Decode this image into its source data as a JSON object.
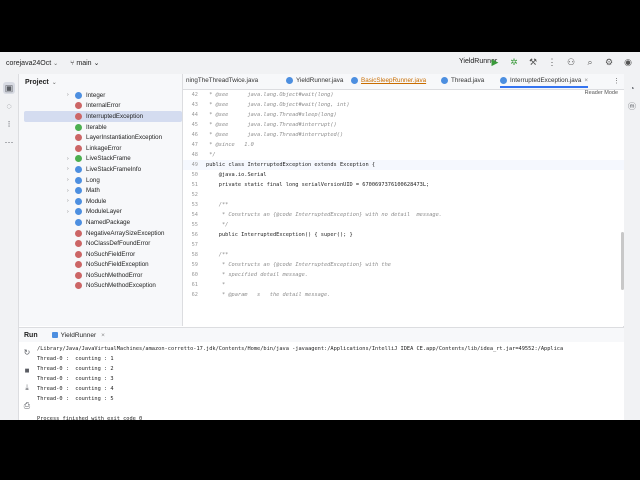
{
  "titlebar": {
    "project": "corejava24Oct",
    "branch": "main",
    "run_config": "YieldRunner"
  },
  "project_panel": {
    "title": "Project",
    "items": [
      {
        "label": "Integer",
        "kind": "class",
        "arrow": true
      },
      {
        "label": "InternalError",
        "kind": "error",
        "arrow": false
      },
      {
        "label": "InterruptedException",
        "kind": "error",
        "arrow": false,
        "selected": true
      },
      {
        "label": "Iterable",
        "kind": "interface",
        "arrow": false
      },
      {
        "label": "LayerInstantiationException",
        "kind": "error",
        "arrow": false
      },
      {
        "label": "LinkageError",
        "kind": "error",
        "arrow": false
      },
      {
        "label": "LiveStackFrame",
        "kind": "interface",
        "arrow": true
      },
      {
        "label": "LiveStackFrameInfo",
        "kind": "class",
        "arrow": true
      },
      {
        "label": "Long",
        "kind": "class",
        "arrow": true
      },
      {
        "label": "Math",
        "kind": "class",
        "arrow": true
      },
      {
        "label": "Module",
        "kind": "class",
        "arrow": true
      },
      {
        "label": "ModuleLayer",
        "kind": "class",
        "arrow": true
      },
      {
        "label": "NamedPackage",
        "kind": "class",
        "arrow": false
      },
      {
        "label": "NegativeArraySizeException",
        "kind": "error",
        "arrow": false
      },
      {
        "label": "NoClassDefFoundError",
        "kind": "error",
        "arrow": false
      },
      {
        "label": "NoSuchFieldError",
        "kind": "error",
        "arrow": false
      },
      {
        "label": "NoSuchFieldException",
        "kind": "error",
        "arrow": false
      },
      {
        "label": "NoSuchMethodError",
        "kind": "error",
        "arrow": false
      },
      {
        "label": "NoSuchMethodException",
        "kind": "error",
        "arrow": false
      }
    ]
  },
  "tabs": [
    {
      "label": "ningTheThreadTwice.java",
      "state": "normal"
    },
    {
      "label": "YieldRunner.java",
      "state": "normal"
    },
    {
      "label": "BasicSleepRunner.java",
      "state": "modified"
    },
    {
      "label": "Thread.java",
      "state": "normal"
    },
    {
      "label": "InterruptedException.java",
      "state": "active"
    }
  ],
  "editor": {
    "reader_mode": "Reader Mode",
    "lines": [
      {
        "n": "42",
        "text": " * @see      java.lang.Object#wait(long)"
      },
      {
        "n": "43",
        "text": " * @see      java.lang.Object#wait(long, int)"
      },
      {
        "n": "44",
        "text": " * @see      java.lang.Thread#sleep(long)"
      },
      {
        "n": "45",
        "text": " * @see      java.lang.Thread#interrupt()"
      },
      {
        "n": "46",
        "text": " * @see      java.lang.Thread#interrupted()"
      },
      {
        "n": "47",
        "text": " * @since   1.0"
      },
      {
        "n": "48",
        "text": " */"
      },
      {
        "n": "49",
        "text": "public class InterruptedException extends Exception {"
      },
      {
        "n": "50",
        "text": "    @java.io.Serial"
      },
      {
        "n": "51",
        "text": "    private static final long serialVersionUID = 6700697376100628473L;"
      },
      {
        "n": "52",
        "text": ""
      },
      {
        "n": "53",
        "text": "    /**"
      },
      {
        "n": "54",
        "text": "     * Constructs an {@code InterruptedException} with no detail  message."
      },
      {
        "n": "55",
        "text": "     */"
      },
      {
        "n": "56",
        "text": "    public InterruptedException() { super(); }"
      },
      {
        "n": "57",
        "text": ""
      },
      {
        "n": "58",
        "text": "    /**"
      },
      {
        "n": "59",
        "text": "     * Constructs an {@code InterruptedException} with the"
      },
      {
        "n": "60",
        "text": "     * specified detail message."
      },
      {
        "n": "61",
        "text": "     *"
      },
      {
        "n": "62",
        "text": "     * @param   s   the detail message."
      }
    ]
  },
  "run_panel": {
    "title": "Run",
    "tab": "YieldRunner",
    "output": [
      "/Library/Java/JavaVirtualMachines/amazon-corretto-17.jdk/Contents/Home/bin/java -javaagent:/Applications/IntelliJ IDEA CE.app/Contents/lib/idea_rt.jar=49552:/Applica",
      "Thread-0 :  counting : 1",
      "Thread-0 :  counting : 2",
      "Thread-0 :  counting : 3",
      "Thread-0 :  counting : 4",
      "Thread-0 :  counting : 5",
      "",
      "Process finished with exit code 0"
    ]
  }
}
